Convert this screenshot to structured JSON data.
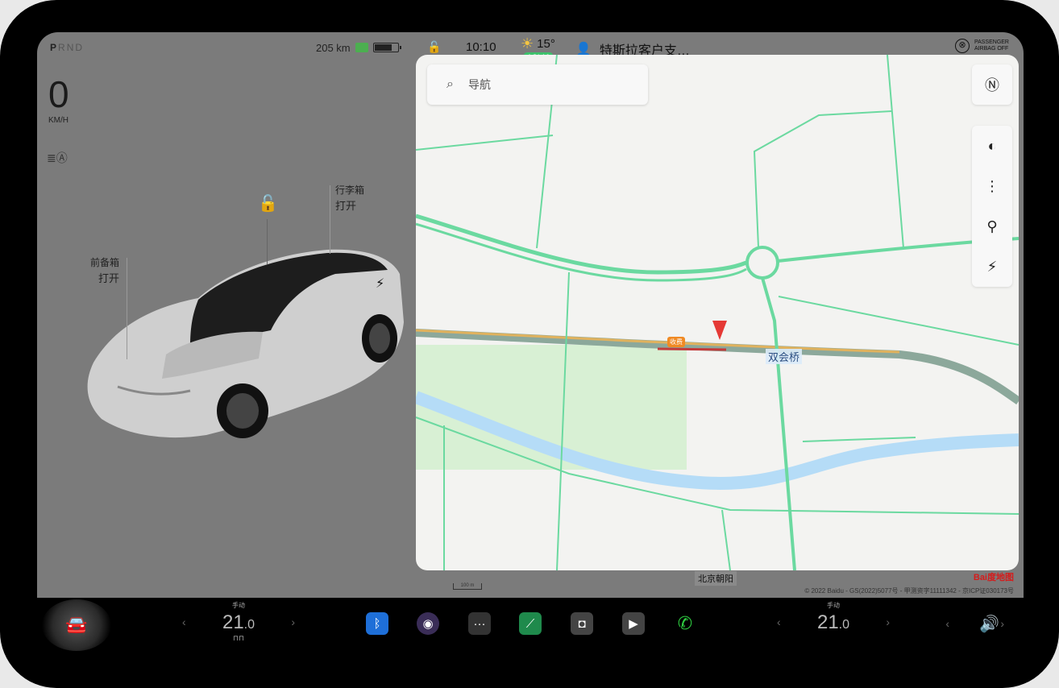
{
  "gear": {
    "letters": [
      "P",
      "R",
      "N",
      "D"
    ],
    "active": "P"
  },
  "battery": {
    "range": "205 km",
    "level": 0.7
  },
  "speed": {
    "value": "0",
    "unit": "KM/H"
  },
  "car": {
    "trunk_label": "行李箱",
    "trunk_state": "打开",
    "frunk_label": "前备箱",
    "frunk_state": "打开"
  },
  "status": {
    "time": "10:10",
    "temperature": "15°",
    "aqi": "AQI 16",
    "profile": "特斯拉客户支…",
    "airbag_line1": "PASSENGER",
    "airbag_line2": "AIRBAG OFF"
  },
  "map": {
    "search_placeholder": "导航",
    "street": "双会桥",
    "toll": "收费",
    "district": "北京朝阳",
    "scale": "100 m",
    "copyright": "© 2022 Baidu - GS(2022)5077号 - 甲测资字11111342 - 京ICP证030173号",
    "logo": "Bai度地图"
  },
  "dock": {
    "left_temp": {
      "mode": "手动",
      "value": "21",
      "decimal": ".0"
    },
    "right_temp": {
      "mode": "手动",
      "value": "21",
      "decimal": ".0"
    }
  },
  "colors": {
    "bluetooth": "#1e6fd8",
    "charts": "#1f8a4c",
    "phone": "#2ecc40",
    "road_green": "#5fd39a",
    "river": "#a9d4f5"
  }
}
